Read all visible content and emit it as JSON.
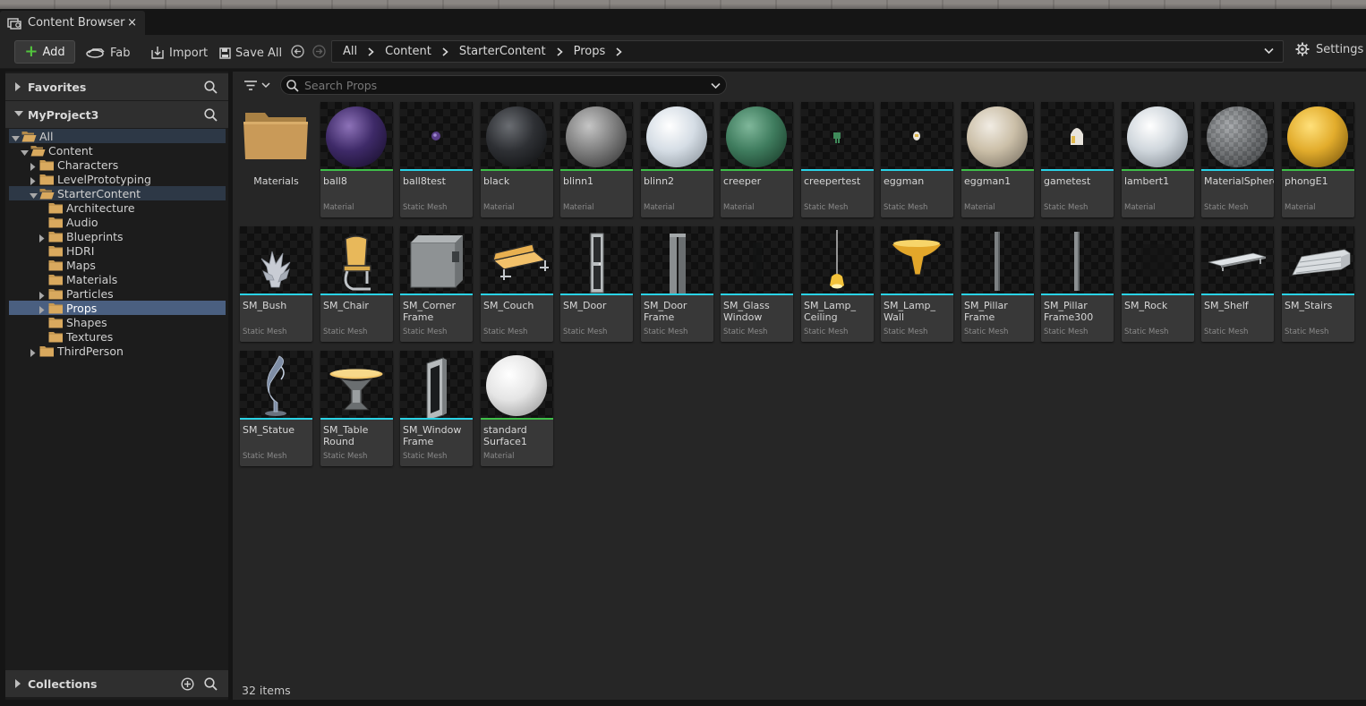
{
  "window": {
    "tab_title": "Content Browser",
    "tab_close": "×"
  },
  "toolbar": {
    "add_label": "Add",
    "fab_label": "Fab",
    "import_label": "Import",
    "save_all_label": "Save All",
    "settings_label": "Settings",
    "breadcrumb": [
      "All",
      "Content",
      "StarterContent",
      "Props"
    ]
  },
  "left_panel": {
    "favorites_label": "Favorites",
    "project_label": "MyProject3",
    "collections_label": "Collections",
    "tree": [
      {
        "label": "All"
      },
      {
        "label": "Content"
      },
      {
        "label": "Characters"
      },
      {
        "label": "LevelPrototyping"
      },
      {
        "label": "StarterContent"
      },
      {
        "label": "Architecture"
      },
      {
        "label": "Audio"
      },
      {
        "label": "Blueprints"
      },
      {
        "label": "HDRI"
      },
      {
        "label": "Maps"
      },
      {
        "label": "Materials"
      },
      {
        "label": "Particles"
      },
      {
        "label": "Props"
      },
      {
        "label": "Shapes"
      },
      {
        "label": "Textures"
      },
      {
        "label": "ThirdPerson"
      }
    ]
  },
  "search": {
    "placeholder": "Search Props",
    "value": ""
  },
  "assets": [
    {
      "name": "Materials",
      "type": ""
    },
    {
      "name": "ball8",
      "type": "Material"
    },
    {
      "name": "ball8test",
      "type": "Static Mesh"
    },
    {
      "name": "black",
      "type": "Material"
    },
    {
      "name": "blinn1",
      "type": "Material"
    },
    {
      "name": "blinn2",
      "type": "Material"
    },
    {
      "name": "creeper",
      "type": "Material"
    },
    {
      "name": "creepertest",
      "type": "Static Mesh"
    },
    {
      "name": "eggman",
      "type": "Static Mesh"
    },
    {
      "name": "eggman1",
      "type": "Material"
    },
    {
      "name": "gametest",
      "type": "Static Mesh"
    },
    {
      "name": "lambert1",
      "type": "Material"
    },
    {
      "name": "MaterialSphere",
      "type": "Static Mesh"
    },
    {
      "name": "phongE1",
      "type": "Material"
    },
    {
      "name": "SM_Bush",
      "type": "Static Mesh"
    },
    {
      "name": "SM_Chair",
      "type": "Static Mesh"
    },
    {
      "name": "SM_Corner\nFrame",
      "type": "Static Mesh"
    },
    {
      "name": "SM_Couch",
      "type": "Static Mesh"
    },
    {
      "name": "SM_Door",
      "type": "Static Mesh"
    },
    {
      "name": "SM_Door\nFrame",
      "type": "Static Mesh"
    },
    {
      "name": "SM_Glass\nWindow",
      "type": "Static Mesh"
    },
    {
      "name": "SM_Lamp_\nCeiling",
      "type": "Static Mesh"
    },
    {
      "name": "SM_Lamp_\nWall",
      "type": "Static Mesh"
    },
    {
      "name": "SM_Pillar\nFrame",
      "type": "Static Mesh"
    },
    {
      "name": "SM_Pillar\nFrame300",
      "type": "Static Mesh"
    },
    {
      "name": "SM_Rock",
      "type": "Static Mesh"
    },
    {
      "name": "SM_Shelf",
      "type": "Static Mesh"
    },
    {
      "name": "SM_Stairs",
      "type": "Static Mesh"
    },
    {
      "name": "SM_Statue",
      "type": "Static Mesh"
    },
    {
      "name": "SM_Table\nRound",
      "type": "Static Mesh"
    },
    {
      "name": "SM_Window\nFrame",
      "type": "Static Mesh"
    },
    {
      "name": "standard\nSurface1",
      "type": "Material"
    }
  ],
  "status": {
    "item_count": "32 items"
  },
  "colors": {
    "material_bar": "#3fbf4a",
    "static_mesh_bar": "#2ad3e6",
    "accent_green": "#52c43d",
    "selection_blue": "#4a5f80"
  }
}
